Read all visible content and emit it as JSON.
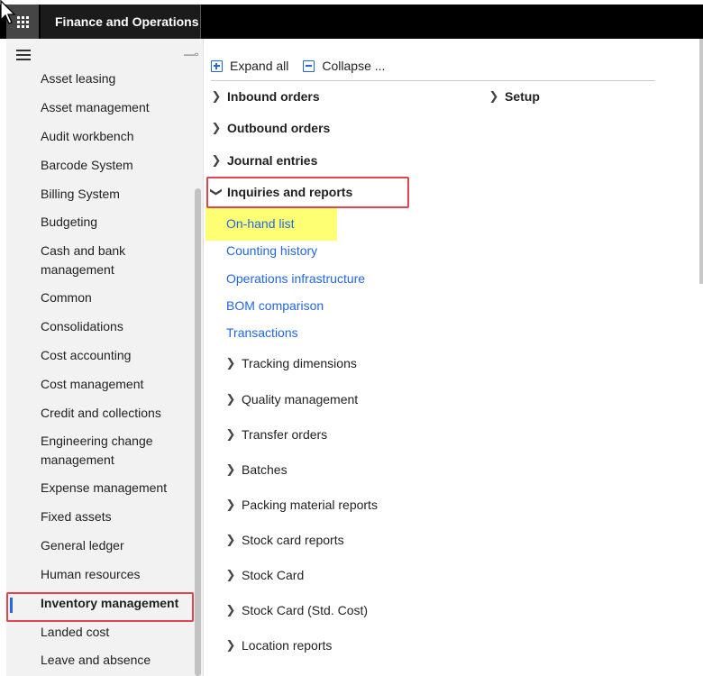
{
  "topbar": {
    "app_title": "Finance and Operations"
  },
  "nav": {
    "items": [
      "Asset leasing",
      "Asset management",
      "Audit workbench",
      "Barcode System",
      "Billing System",
      "Budgeting",
      "Cash and bank management",
      "Common",
      "Consolidations",
      "Cost accounting",
      "Cost management",
      "Credit and collections",
      "Engineering change management",
      "Expense management",
      "Fixed assets",
      "General ledger",
      "Human resources",
      "Inventory management",
      "Landed cost",
      "Leave and absence"
    ],
    "selected": "Inventory management"
  },
  "toolbar": {
    "expand_all": "Expand all",
    "collapse_all": "Collapse ..."
  },
  "groups": {
    "inbound": "Inbound orders",
    "outbound": "Outbound orders",
    "journal": "Journal entries",
    "inquiries": "Inquiries and reports",
    "setup": "Setup"
  },
  "inquiry_links": [
    "On-hand list",
    "Counting history",
    "Operations infrastructure",
    "BOM comparison",
    "Transactions"
  ],
  "sub_groups": [
    "Tracking dimensions",
    "Quality management",
    "Transfer orders",
    "Batches",
    "Packing material reports",
    "Stock card reports",
    "Stock Card",
    "Stock Card (Std. Cost)",
    "Location reports"
  ],
  "colors": {
    "link": "#2266e3",
    "highlight": "#ffff5c",
    "annotation": "#e0444f",
    "topbar": "#000000"
  }
}
